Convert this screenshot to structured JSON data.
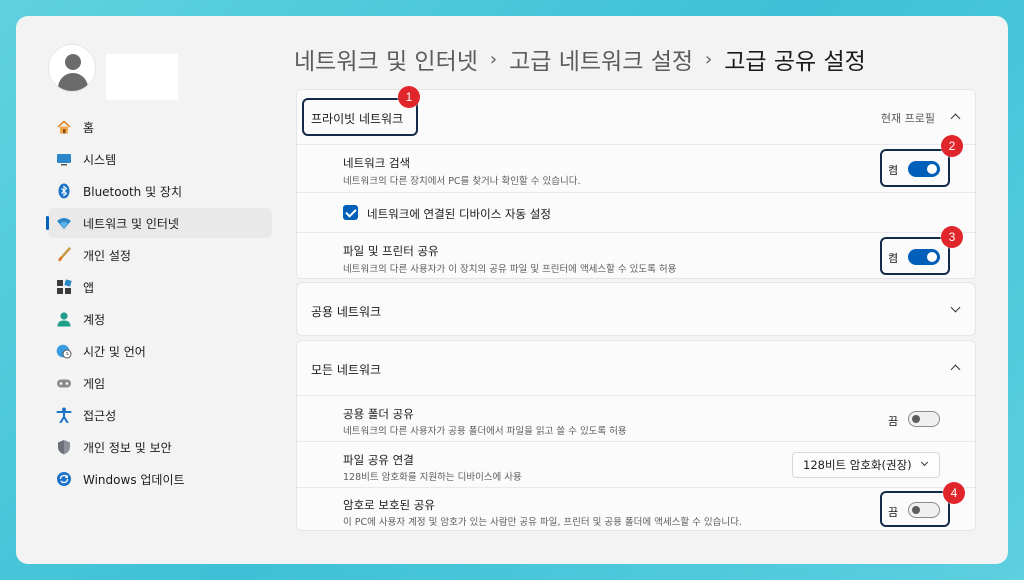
{
  "breadcrumb": {
    "items": [
      "네트워크 및 인터넷",
      "고급 네트워크 설정",
      "고급 공유 설정"
    ],
    "separator": "›"
  },
  "sidebar": {
    "items": [
      {
        "label": "홈",
        "icon": "home-icon"
      },
      {
        "label": "시스템",
        "icon": "system-icon"
      },
      {
        "label": "Bluetooth 및 장치",
        "icon": "bluetooth-icon"
      },
      {
        "label": "네트워크 및 인터넷",
        "icon": "wifi-icon",
        "active": true
      },
      {
        "label": "개인 설정",
        "icon": "brush-icon"
      },
      {
        "label": "앱",
        "icon": "apps-icon"
      },
      {
        "label": "계정",
        "icon": "account-icon"
      },
      {
        "label": "시간 및 언어",
        "icon": "clock-globe-icon"
      },
      {
        "label": "게임",
        "icon": "gamepad-icon"
      },
      {
        "label": "접근성",
        "icon": "accessibility-icon"
      },
      {
        "label": "개인 정보 및 보안",
        "icon": "shield-icon"
      },
      {
        "label": "Windows 업데이트",
        "icon": "update-icon"
      }
    ]
  },
  "private_network": {
    "title": "프라이빗 네트워크",
    "profile_label": "현재 프로필",
    "discovery": {
      "title": "네트워크 검색",
      "desc": "네트워크의 다른 장치에서 PC를 찾거나 확인할 수 있습니다.",
      "state": "켬",
      "on": true
    },
    "auto_setup": {
      "label": "네트워크에 연결된 디바이스 자동 설정",
      "checked": true
    },
    "file_printer": {
      "title": "파일 및 프린터 공유",
      "desc": "네트워크의 다른 사용자가 이 장치의 공유 파일 및 프린터에 액세스할 수 있도록 허용",
      "state": "켬",
      "on": true
    }
  },
  "public_network": {
    "title": "공용 네트워크"
  },
  "all_networks": {
    "title": "모든 네트워크",
    "public_folder": {
      "title": "공용 폴더 공유",
      "desc": "네트워크의 다른 사용자가 공용 폴더에서 파일을 읽고 쓸 수 있도록 허용",
      "state": "끔",
      "on": false
    },
    "file_sharing": {
      "title": "파일 공유 연결",
      "desc": "128비트 암호화를 지원하는 디바이스에 사용",
      "value": "128비트 암호화(권장)"
    },
    "password_protected": {
      "title": "암호로 보호된 공유",
      "desc": "이 PC에 사용자 계정 및 암호가 있는 사람만 공유 파일, 프린터 및 공용 폴더에 액세스할 수 있습니다.",
      "state": "끔",
      "on": false
    }
  },
  "annotations": [
    "1",
    "2",
    "3",
    "4"
  ],
  "colors": {
    "accent": "#005fb8",
    "badge": "#e0262a",
    "highlight": "#142a4a",
    "background": "#4cc8dc"
  }
}
